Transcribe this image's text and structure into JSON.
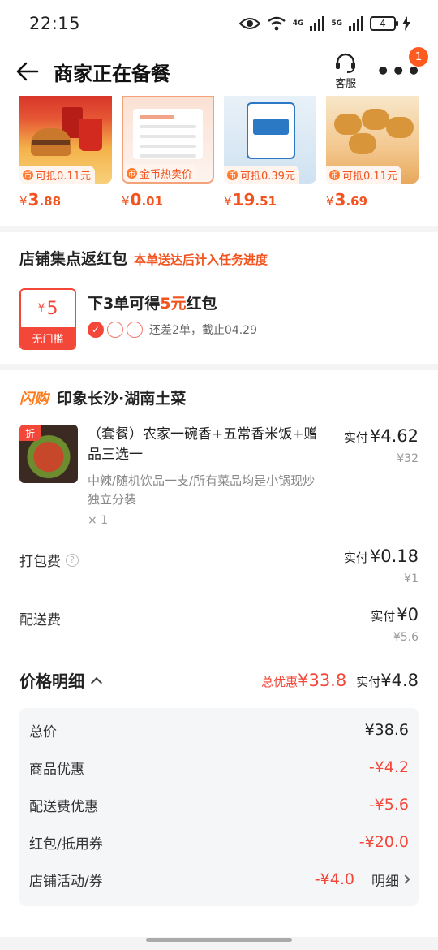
{
  "status_bar": {
    "time": "22:15",
    "net1": "4G",
    "net2": "5G",
    "battery": "4"
  },
  "nav": {
    "title": "商家正在备餐",
    "service_label": "客服",
    "more_badge": "1"
  },
  "products": [
    {
      "coupon": "可抵0.11元",
      "price_int": "3",
      "price_dec": ".88"
    },
    {
      "coupon": "金币热卖价",
      "price_int": "0",
      "price_dec": ".01"
    },
    {
      "coupon": "可抵0.39元",
      "price_int": "19",
      "price_dec": ".51"
    },
    {
      "coupon": "可抵0.11元",
      "price_int": "3",
      "price_dec": ".69"
    }
  ],
  "currency": "¥",
  "stamp": {
    "title": "店铺集点返红包",
    "note": "本单送达后计入任务进度",
    "packet_amount": "5",
    "packet_label": "无门槛",
    "line_pre": "下3单可得",
    "line_hl": "5元",
    "line_post": "红包",
    "progress_text": "还差2单，截止04.29"
  },
  "order": {
    "flash_tag": "闪购",
    "shop_name": "印象长沙·湖南土菜",
    "item": {
      "badge": "折",
      "name": "（套餐）农家一碗香+五常香米饭+赠品三选一",
      "spec": "中辣/随机饮品一支/所有菜品均是小锅现炒独立分装",
      "qty": "× 1",
      "paid_label": "实付",
      "paid": "¥4.62",
      "orig": "¥32"
    },
    "packing": {
      "label": "打包费",
      "paid_label": "实付",
      "paid": "¥0.18",
      "orig": "¥1"
    },
    "delivery": {
      "label": "配送费",
      "paid_label": "实付",
      "paid": "¥0",
      "orig": "¥5.6"
    },
    "detail": {
      "title": "价格明细",
      "disc_label": "总优惠",
      "disc": "¥33.8",
      "final_label": "实付",
      "final": "¥4.8"
    },
    "breakdown": [
      {
        "label": "总价",
        "value": "¥38.6"
      },
      {
        "label": "商品优惠",
        "value": "-¥4.2"
      },
      {
        "label": "配送费优惠",
        "value": "-¥5.6"
      },
      {
        "label": "红包/抵用券",
        "value": "-¥20.0"
      },
      {
        "label": "店铺活动/券",
        "value": "-¥4.0",
        "link": "明细"
      }
    ]
  }
}
